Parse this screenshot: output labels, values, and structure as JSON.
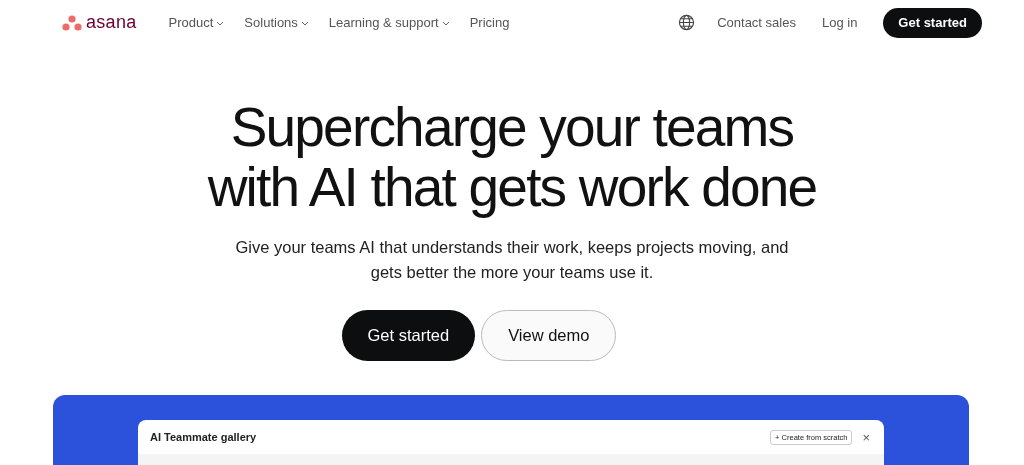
{
  "brand": {
    "name": "asana"
  },
  "nav": [
    {
      "label": "Product",
      "dropdown": true
    },
    {
      "label": "Solutions",
      "dropdown": true
    },
    {
      "label": "Learning & support",
      "dropdown": true
    },
    {
      "label": "Pricing",
      "dropdown": false
    }
  ],
  "nav_right": {
    "contact": "Contact sales",
    "login": "Log in",
    "cta": "Get started"
  },
  "hero": {
    "title_lines": [
      "Supercharge your teams",
      "with AI that gets work done"
    ],
    "subtitle_lines": [
      "Give your teams AI that understands their work, keeps projects moving, and",
      "gets better the more your teams use it."
    ],
    "primary": "Get started",
    "secondary": "View demo"
  },
  "preview": {
    "title": "AI Teammate gallery",
    "create_button": "+ Create from scratch",
    "close": "×"
  }
}
